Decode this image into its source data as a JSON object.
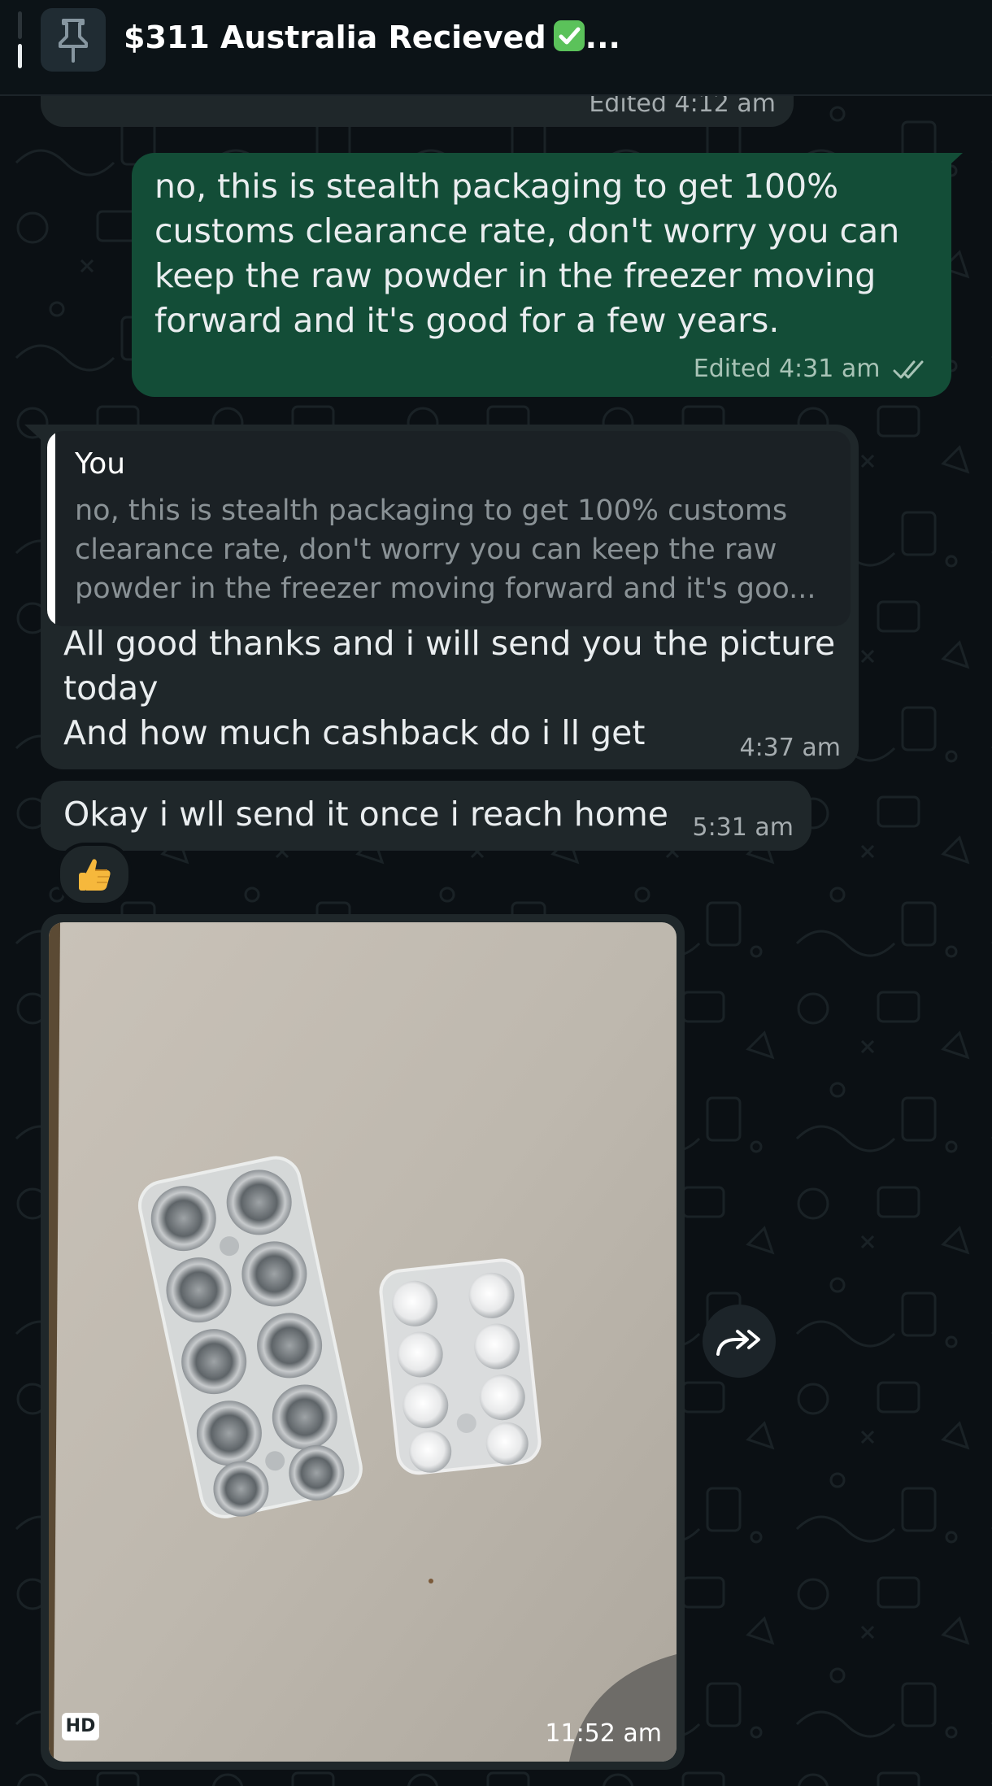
{
  "pinned": {
    "title": "$311 Australia Recieved",
    "title_suffix": "...",
    "pin_icon": "pin-icon",
    "badge_icon": "check-mark-button-emoji"
  },
  "messages": [
    {
      "id": "partial_top",
      "direction": "incoming",
      "edited_label": "Edited",
      "time": "4:12 am"
    },
    {
      "id": "outgoing_1",
      "direction": "outgoing",
      "text": "no, this is stealth packaging to get 100% customs clearance rate, don't worry you can keep the raw powder in the freezer moving forward and it's good for a few years.",
      "edited_label": "Edited",
      "time": "4:31 am",
      "status_icon": "double-check-icon"
    },
    {
      "id": "incoming_reply",
      "direction": "incoming",
      "quote": {
        "author": "You",
        "text": "no, this is stealth packaging to get 100% customs clearance rate, don't worry you can keep the raw powder in the freezer moving forward and it's goo..."
      },
      "text_line1": "All good thanks and i will send you the picture today",
      "text_line2": "And how much cashback do i ll get",
      "time": "4:37 am"
    },
    {
      "id": "incoming_2",
      "direction": "incoming",
      "text": "Okay i wll send it once i reach home",
      "time": "5:31 am",
      "reaction": "thumbs-up"
    },
    {
      "id": "incoming_photo",
      "direction": "incoming",
      "type": "image",
      "hd_label": "HD",
      "time": "11:52 am"
    }
  ],
  "forward_button": {
    "icon": "forward-icon"
  },
  "colors": {
    "background": "#0b1014",
    "incoming_bubble": "#1f272a",
    "outgoing_bubble": "#134d37",
    "header": "#0c1317"
  }
}
